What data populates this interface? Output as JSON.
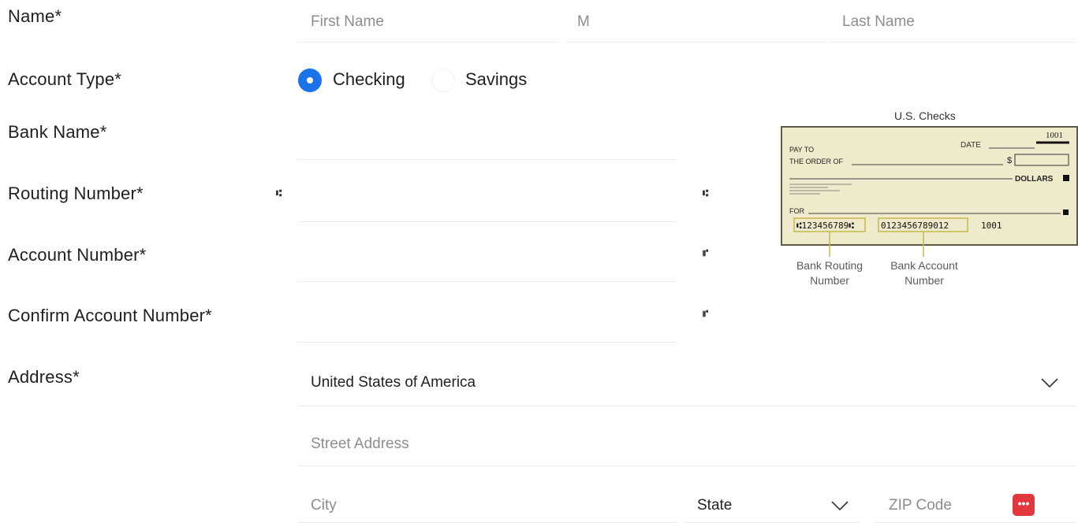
{
  "labels": {
    "name": "Name*",
    "account_type": "Account Type*",
    "bank_name": "Bank Name*",
    "routing_number": "Routing Number*",
    "account_number": "Account Number*",
    "confirm_account_number": "Confirm Account Number*",
    "address": "Address*"
  },
  "name": {
    "first_placeholder": "First Name",
    "middle_placeholder": "M",
    "last_placeholder": "Last Name"
  },
  "account_type": {
    "options": [
      {
        "label": "Checking",
        "selected": true
      },
      {
        "label": "Savings",
        "selected": false
      }
    ]
  },
  "check_example": {
    "caption": "U.S. Checks",
    "check_number": "1001",
    "date_label": "DATE",
    "pay_to_line1": "PAY TO",
    "pay_to_line2": "THE ORDER OF",
    "dollar_sign": "$",
    "dollars_label": "DOLLARS",
    "for_label": "FOR",
    "routing_sample": "⑆123456789⑆",
    "account_sample": "0123456789012",
    "number_sample": "1001",
    "routing_callout": "Bank Routing Number",
    "account_callout": "Bank Account Number"
  },
  "address": {
    "country_value": "United States of America",
    "street_placeholder": "Street Address",
    "city_placeholder": "City",
    "state_value": "State",
    "zip_placeholder": "ZIP Code",
    "zip_badge": "•••"
  },
  "icons": {
    "routing_mark": "routing-symbol-icon",
    "account_mark": "account-symbol-icon",
    "dropdown": "chevron-down-icon"
  },
  "colors": {
    "accent": "#1a73e8",
    "badge": "#e0383e"
  }
}
